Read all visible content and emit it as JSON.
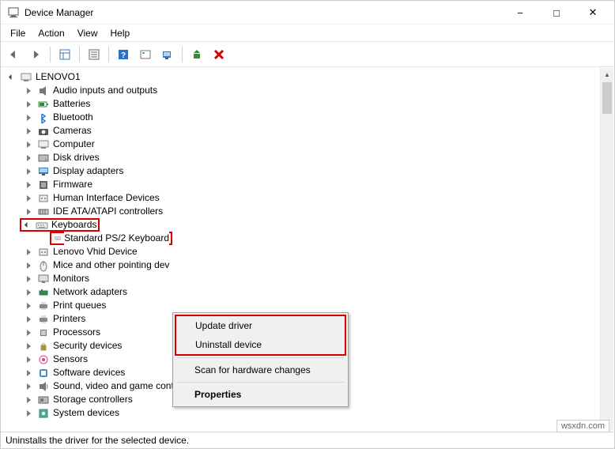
{
  "window": {
    "title": "Device Manager"
  },
  "menubar": [
    "File",
    "Action",
    "View",
    "Help"
  ],
  "root": "LENOVO1",
  "categories": [
    {
      "name": "Audio inputs and outputs",
      "icon": "speaker"
    },
    {
      "name": "Batteries",
      "icon": "battery"
    },
    {
      "name": "Bluetooth",
      "icon": "bluetooth"
    },
    {
      "name": "Cameras",
      "icon": "camera"
    },
    {
      "name": "Computer",
      "icon": "computer"
    },
    {
      "name": "Disk drives",
      "icon": "disk"
    },
    {
      "name": "Display adapters",
      "icon": "display"
    },
    {
      "name": "Firmware",
      "icon": "firmware"
    },
    {
      "name": "Human Interface Devices",
      "icon": "hid"
    },
    {
      "name": "IDE ATA/ATAPI controllers",
      "icon": "ide"
    },
    {
      "name": "Keyboards",
      "icon": "keyboard",
      "expanded": true,
      "highlighted": true,
      "children": [
        {
          "name": "Standard PS/2 Keyboard",
          "icon": "keyboard",
          "selected": true
        }
      ]
    },
    {
      "name": "Lenovo Vhid Device",
      "icon": "hid"
    },
    {
      "name": "Mice and other pointing dev",
      "icon": "mouse"
    },
    {
      "name": "Monitors",
      "icon": "monitor"
    },
    {
      "name": "Network adapters",
      "icon": "network"
    },
    {
      "name": "Print queues",
      "icon": "printer"
    },
    {
      "name": "Printers",
      "icon": "printer"
    },
    {
      "name": "Processors",
      "icon": "cpu"
    },
    {
      "name": "Security devices",
      "icon": "security"
    },
    {
      "name": "Sensors",
      "icon": "sensor"
    },
    {
      "name": "Software devices",
      "icon": "software"
    },
    {
      "name": "Sound, video and game controllers",
      "icon": "sound"
    },
    {
      "name": "Storage controllers",
      "icon": "storage"
    },
    {
      "name": "System devices",
      "icon": "system"
    }
  ],
  "context_menu": {
    "items": [
      {
        "label": "Update driver",
        "highlighted": true
      },
      {
        "label": "Uninstall device",
        "highlighted": true
      },
      {
        "sep": true
      },
      {
        "label": "Scan for hardware changes"
      },
      {
        "sep": true
      },
      {
        "label": "Properties",
        "bold": true
      }
    ]
  },
  "statusbar": "Uninstalls the driver for the selected device.",
  "watermark": "wsxdn.com"
}
